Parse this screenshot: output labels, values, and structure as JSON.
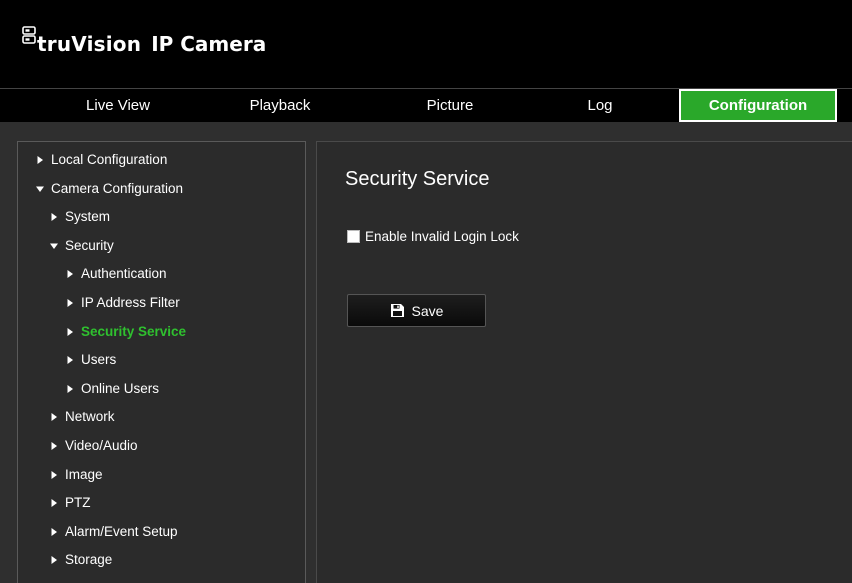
{
  "header": {
    "brand": "truVision",
    "product": "IP Camera",
    "logo_icon": "camera-logo-icon"
  },
  "nav": {
    "tabs": [
      {
        "label": "Live View",
        "active": false
      },
      {
        "label": "Playback",
        "active": false
      },
      {
        "label": "Picture",
        "active": false
      },
      {
        "label": "Log",
        "active": false
      },
      {
        "label": "Configuration",
        "active": true
      }
    ]
  },
  "sidebar": {
    "items": [
      {
        "label": "Local Configuration",
        "expanded": false,
        "level": 0
      },
      {
        "label": "Camera Configuration",
        "expanded": true,
        "level": 0
      },
      {
        "label": "System",
        "expanded": false,
        "level": 1
      },
      {
        "label": "Security",
        "expanded": true,
        "level": 1
      },
      {
        "label": "Authentication",
        "expanded": false,
        "level": 2
      },
      {
        "label": "IP Address Filter",
        "expanded": false,
        "level": 2
      },
      {
        "label": "Security Service",
        "expanded": false,
        "level": 2,
        "active": true
      },
      {
        "label": "Users",
        "expanded": false,
        "level": 2
      },
      {
        "label": "Online Users",
        "expanded": false,
        "level": 2
      },
      {
        "label": "Network",
        "expanded": false,
        "level": 1
      },
      {
        "label": "Video/Audio",
        "expanded": false,
        "level": 1
      },
      {
        "label": "Image",
        "expanded": false,
        "level": 1
      },
      {
        "label": "PTZ",
        "expanded": false,
        "level": 1
      },
      {
        "label": "Alarm/Event Setup",
        "expanded": false,
        "level": 1
      },
      {
        "label": "Storage",
        "expanded": false,
        "level": 1
      }
    ]
  },
  "main": {
    "title": "Security Service",
    "invalid_login_lock": {
      "label": "Enable Invalid Login Lock",
      "checked": false
    },
    "save_label": "Save",
    "save_icon": "save-icon"
  },
  "colors": {
    "accent": "#2aa82a",
    "active_text": "#2fc02f",
    "background": "#2f2f2f",
    "header": "#000000"
  }
}
